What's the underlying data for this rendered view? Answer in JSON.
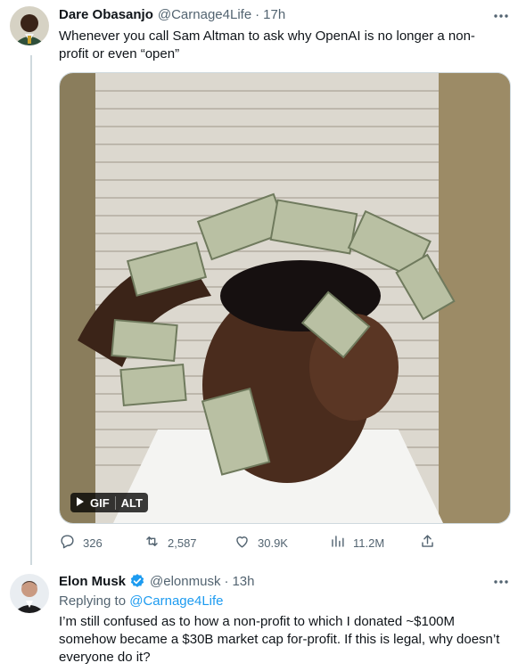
{
  "tweet1": {
    "author_name": "Dare Obasanjo",
    "handle": "@Carnage4Life",
    "separator": "·",
    "time": "17h",
    "text": "Whenever you call Sam Altman to ask why OpenAI is no longer a non-profit or even “open”",
    "media": {
      "gif_label": "GIF",
      "alt_label": "ALT"
    },
    "stats": {
      "replies": "326",
      "retweets": "2,587",
      "likes": "30.9K",
      "views": "11.2M"
    }
  },
  "tweet2": {
    "author_name": "Elon Musk",
    "handle": "@elonmusk",
    "separator": "·",
    "time": "13h",
    "replying_prefix": "Replying to ",
    "replying_to": "@Carnage4Life",
    "text": "I’m still confused as to how a non-profit to which I donated ~$100M somehow became a $30B market cap for-profit. If this is legal, why doesn’t everyone do it?"
  },
  "colors": {
    "muted": "#536471",
    "accent": "#1d9bf0",
    "verified": "#1d9bf0",
    "divider": "#cfd9de"
  },
  "icons": [
    "reply-icon",
    "retweet-icon",
    "like-icon",
    "views-icon",
    "share-icon",
    "more-icon",
    "verified-icon",
    "play-icon"
  ]
}
